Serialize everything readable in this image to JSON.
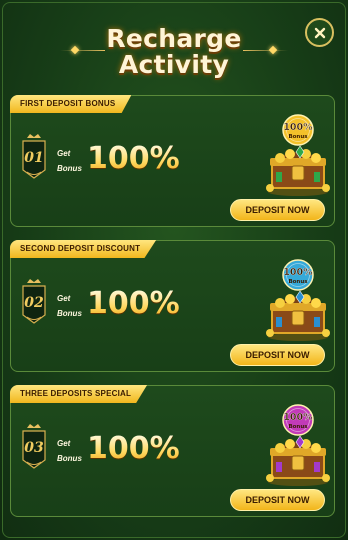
{
  "header": {
    "title_line1": "Recharge",
    "title_line2": "Activity"
  },
  "close": {
    "icon": "close-icon"
  },
  "colors": {
    "gold": "#f2b51a",
    "green_bg": "#173d17",
    "card_border": "#5a8a3a"
  },
  "cards": [
    {
      "tag": "FIRST DEPOSIT BONUS",
      "number": "01",
      "get": "Get",
      "bonus_word": "Bonus",
      "percent": "100%",
      "chest_badge_pct": "100%",
      "chest_badge_word": "Bonus",
      "badge_color": "#f3c12a",
      "gem_color": "#2fa84a",
      "button": "DEPOSIT NOW"
    },
    {
      "tag": "SECOND DEPOSIT DISCOUNT",
      "number": "02",
      "get": "Get",
      "bonus_word": "Bonus",
      "percent": "100%",
      "chest_badge_pct": "100%",
      "chest_badge_word": "Bonus",
      "badge_color": "#36a9d8",
      "gem_color": "#2a8fd0",
      "button": "DEPOSIT NOW"
    },
    {
      "tag": "THREE DEPOSITS SPECIAL",
      "number": "03",
      "get": "Get",
      "bonus_word": "Bonus",
      "percent": "100%",
      "chest_badge_pct": "100%",
      "chest_badge_word": "Bonus",
      "badge_color": "#c23ab8",
      "gem_color": "#a33acb",
      "button": "DEPOSIT NOW"
    }
  ]
}
